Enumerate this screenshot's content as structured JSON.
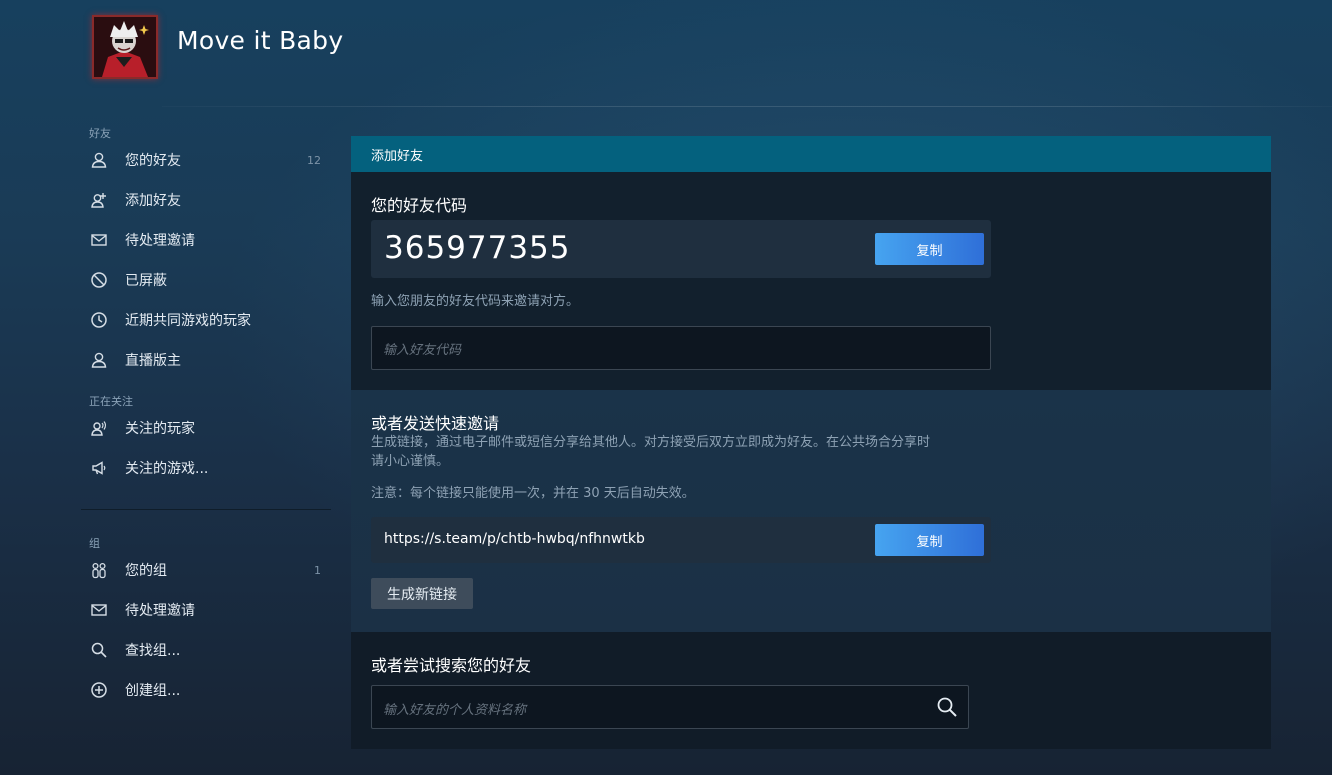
{
  "profile": {
    "name": "Move it Baby"
  },
  "sidebar": {
    "friends_section": "好友",
    "friends_items": [
      {
        "label": "您的好友",
        "count": "12",
        "icon": "person-icon"
      },
      {
        "label": "添加好友",
        "icon": "add-person-icon"
      },
      {
        "label": "待处理邀请",
        "icon": "envelope-icon"
      },
      {
        "label": "已屏蔽",
        "icon": "blocked-icon"
      },
      {
        "label": "近期共同游戏的玩家",
        "icon": "clock-icon"
      },
      {
        "label": "直播版主",
        "icon": "person-icon"
      }
    ],
    "following_section": "正在关注",
    "following_items": [
      {
        "label": "关注的玩家",
        "icon": "person-broadcast-icon"
      },
      {
        "label": "关注的游戏...",
        "icon": "megaphone-icon"
      }
    ],
    "groups_section": "组",
    "groups_items": [
      {
        "label": "您的组",
        "count": "1",
        "icon": "group-icon"
      },
      {
        "label": "待处理邀请",
        "icon": "envelope-icon"
      },
      {
        "label": "查找组...",
        "icon": "search-icon"
      },
      {
        "label": "创建组...",
        "icon": "plus-circle-icon"
      }
    ]
  },
  "main": {
    "header": "添加好友",
    "friend_code": {
      "title": "您的好友代码",
      "value": "365977355",
      "copy_label": "复制",
      "hint": "输入您朋友的好友代码来邀请对方。",
      "input_placeholder": "输入好友代码"
    },
    "quick_invite": {
      "title": "或者发送快速邀请",
      "description_line1": "生成链接，通过电子邮件或短信分享给其他人。对方接受后双方立即成为好友。在公共场合分享时",
      "description_line2": "请小心谨慎。",
      "note": "注意：每个链接只能使用一次，并在 30 天后自动失效。",
      "link": "https://s.team/p/chtb-hwbq/nfhnwtkb",
      "copy_label": "复制",
      "generate_label": "生成新链接"
    },
    "search": {
      "title": "或者尝试搜索您的好友",
      "placeholder": "输入好友的个人资料名称"
    }
  },
  "colors": {
    "accent_header": "#04617e",
    "button_blue": "#46a4f0",
    "page_bg": "#1b2838"
  }
}
